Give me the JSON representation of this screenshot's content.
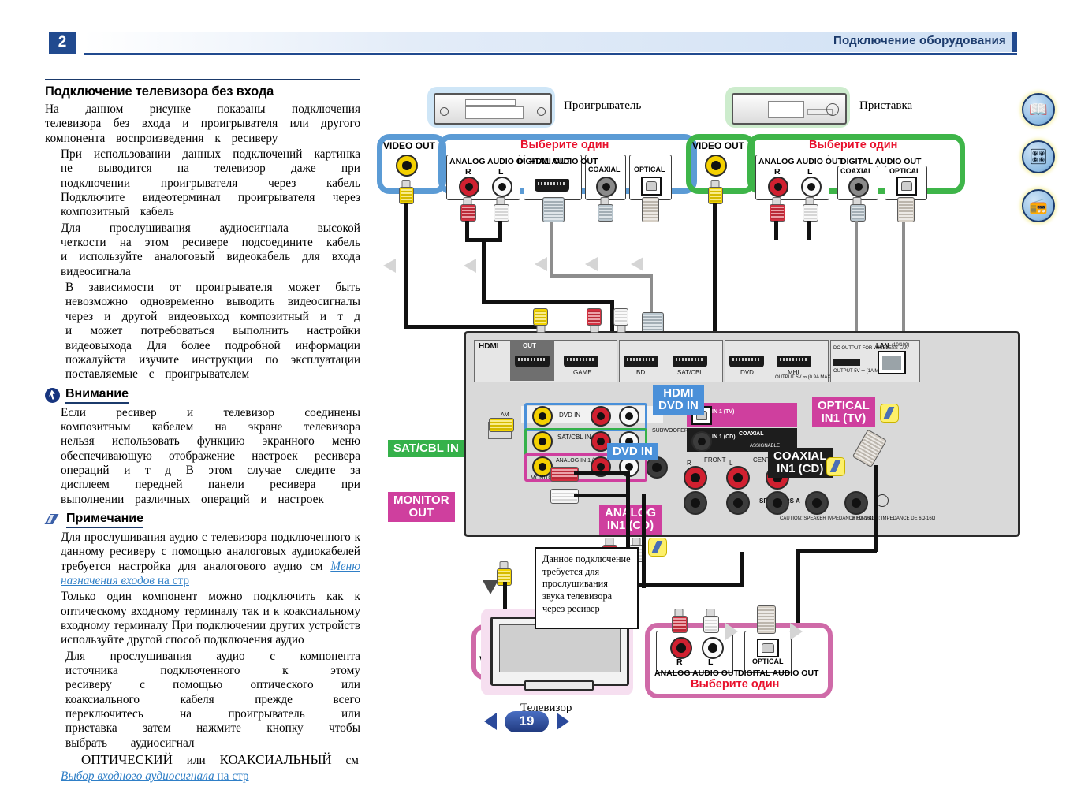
{
  "header": {
    "chapter": "2",
    "title": "Подключение оборудования"
  },
  "left_column": {
    "section_title": "Подключение телевизора без входа",
    "paragraphs": [
      "На данном рисунке показаны подключения телевизора  без входа          и проигрывателя          или другого компонента воспроизведения  к ресиверу",
      "При использовании данных подключений  картинка не выводится на телевизор даже при подключении проигрывателя        через кабель          Подключите видеотерминал проигрывателя        через композитный кабель",
      "Для прослушивания аудиосигнала высокой четкости на этом ресивере подсоедините кабель          и используйте аналоговый видеокабель для входа видеосигнала",
      "В зависимости от проигрывателя  может быть невозможно одновременно выводить видеосигналы через          и другой видеовыход  композитный и т д   и может потребоваться выполнить настройки видеовыхода  Для более подробной информации  пожалуйста  изучите инструкции по эксплуатации  поставляемые с проигрывателем"
    ],
    "caution": {
      "icon": "caution-icon",
      "heading": "Внимание",
      "text": "Если ресивер и телевизор соединены композитным кабелем  на экране телевизора нельзя использовать функцию экранного меню          обеспечивающую отображение настроек ресивера  операций и т д  В этом случае  следите за дисплеем передней панели ресивера при выполнении различных операций и настроек"
    },
    "note": {
      "icon": "pencil-icon",
      "heading": "Примечание",
      "items": [
        {
          "text": "Для прослушивания аудио с телевизора  подключенного к данному ресиверу с помощью аналоговых аудиокабелей требуется настройка для аналогового аудио  см ",
          "link_italic": "Меню назначения входов",
          "link_tail": " на стр"
        },
        {
          "text": "Только один компонент можно подключить как к оптическому входному терминалу  так и к коаксиальному входному терминалу  При подключении других устройств используйте другой способ подключения аудио"
        },
        {
          "text": "Для прослушивания аудио с компонента источника подключенного к этому ресиверу с помощью оптического или коаксиального кабеля  прежде всего  переключитесь на          проигрыватель          или          приставка затем нажмите кнопку            чтобы выбрать аудиосигнал",
          "emphasis_a": "ОПТИЧЕСКИЙ",
          "emphasis_or": "или",
          "emphasis_b": "КОАКСИАЛЬНЫЙ",
          "emphasis_tail": "см",
          "link_italic": "Выбор входного аудиосигнала",
          "link_tail": " на стр"
        }
      ]
    }
  },
  "side_icons": [
    {
      "name": "manual-book-icon",
      "glyph": "📖"
    },
    {
      "name": "remote-receiver-icon",
      "glyph": "🎛"
    },
    {
      "name": "audio-help-icon",
      "glyph": "📻"
    }
  ],
  "diagram": {
    "device_player": {
      "label": "Проигрыватель",
      "pick_one": "Выберите один",
      "video_out_label": "VIDEO  OUT",
      "groups": {
        "analog_audio_out": "ANALOG AUDIO OUT",
        "hdmi_out": "HDMI OUT",
        "digital_audio_out": "DIGITAL AUDIO OUT",
        "coaxial": "COAXIAL",
        "optical": "OPTICAL",
        "r": "R",
        "l": "L"
      }
    },
    "device_settop": {
      "label": "Приставка",
      "pick_one": "Выберите один",
      "video_out_label": "VIDEO  OUT",
      "groups": {
        "analog_audio_out": "ANALOG AUDIO OUT",
        "digital_audio_out": "DIGITAL AUDIO OUT",
        "coaxial": "COAXIAL",
        "optical": "OPTICAL",
        "r": "R",
        "l": "L"
      }
    },
    "receiver": {
      "hdmi_label": "HDMI",
      "hdmi_out": "OUT",
      "hdmi_ports": [
        "GAME",
        "BD",
        "SAT/CBL",
        "DVD",
        "MHL"
      ],
      "mhl_note": "OUTPUT 5V ⎓ (0.9A MAX)",
      "lan_label": "LAN",
      "lan_sub": "(10/100)",
      "wireless_label": "DC OUTPUT FOR WIRELESS LAN",
      "wireless_sub": "OUTPUT 5V ⎓ (1A MAX)",
      "row_dvd_in": "DVD IN",
      "row_satcbl_in": "SAT/CBL IN",
      "row_analog_in": "ANALOG IN 1 (CD)",
      "monitor_out_small": "MONITOR OUT",
      "am_label": "AM",
      "optical_in_small": "IN 1 (TV)",
      "coaxial_label": "COAXIAL",
      "coaxial_in_small": "IN 1 (CD)",
      "assignable": "ASSIGNABLE",
      "front_label": "FRONT",
      "center_label": "CENTER",
      "surround_label": "SURROUND",
      "subwoofer_label": "SUBWOOFER",
      "speakers_label": "SPEAKERS A",
      "caution_en": "CAUTION: SPEAKER IMPEDANCE 6Ω-16Ω",
      "caution_fr": "ATTENTION: IMPEDANCE DE 6Ω-16Ω",
      "r": "R",
      "l": "L"
    },
    "flags": [
      {
        "name": "hdmi-dvd-in-flag",
        "text": "HDMI\nDVD IN",
        "color": "blue"
      },
      {
        "name": "dvd-in-flag",
        "text": "DVD IN",
        "color": "blue"
      },
      {
        "name": "sat-cbl-in-flag",
        "text": "SAT/CBL IN",
        "color": "green"
      },
      {
        "name": "monitor-out-flag",
        "text": "MONITOR\nOUT",
        "color": "pink"
      },
      {
        "name": "analog-in1-cd-flag",
        "text": "ANALOG\nIN1 (CD)",
        "color": "pink"
      },
      {
        "name": "optical-in1-tv-flag",
        "text": "OPTICAL\nIN1 (TV)",
        "color": "pink"
      },
      {
        "name": "coaxial-in1-cd-flag",
        "text": "COAXIAL\nIN1 (CD)",
        "color": "black"
      }
    ],
    "tv": {
      "label": "Телевизор",
      "video_in_label": "VIDEO IN",
      "pick_one": "Выберите один",
      "analog_audio_out": "ANALOG AUDIO OUT",
      "digital_audio_out": "DIGITAL AUDIO OUT",
      "optical": "OPTICAL",
      "r": "R",
      "l": "L"
    },
    "note_box": "Данное подключение требуется для прослушивания звука телевизора через ресивер"
  },
  "footer": {
    "page_number": "19",
    "prev_icon": "prev-arrow-icon",
    "next_icon": "next-arrow-icon"
  },
  "colors": {
    "header_blue": "#214a8f",
    "player_blue": "#5b9bd5",
    "settop_green": "#3eb549",
    "tv_pink": "#cf6aa8",
    "pick_one_red": "#e8112d"
  }
}
